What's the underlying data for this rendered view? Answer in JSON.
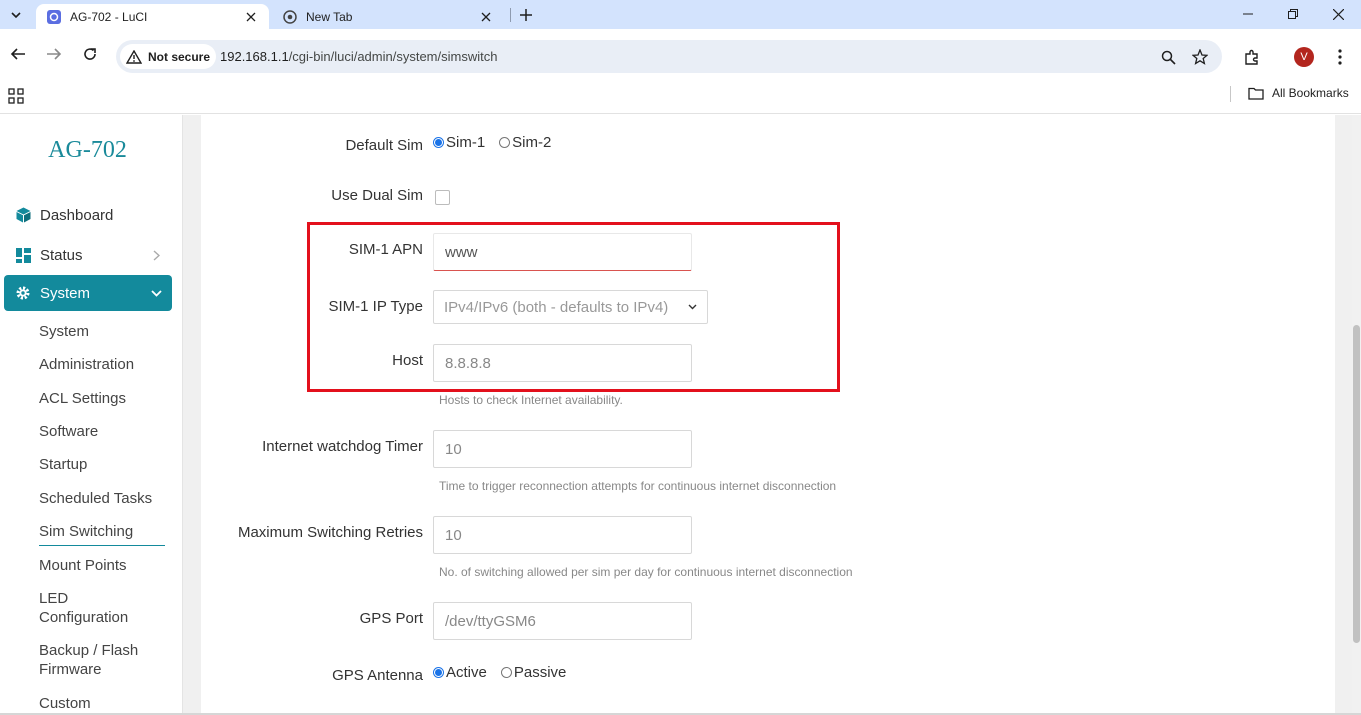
{
  "browser": {
    "tabs": [
      {
        "title": "AG-702 - LuCI",
        "active": true
      },
      {
        "title": "New Tab",
        "active": false
      }
    ],
    "security_label": "Not secure",
    "url_host": "192.168.1.1",
    "url_path": "/cgi-bin/luci/admin/system/simswitch",
    "profile_initial": "V",
    "all_bookmarks": "All Bookmarks"
  },
  "sidebar": {
    "brand": "AG-702",
    "items": [
      {
        "label": "Dashboard",
        "icon": "cube-icon"
      },
      {
        "label": "Status",
        "icon": "grid-icon"
      },
      {
        "label": "System",
        "icon": "gear-icon",
        "active": true
      }
    ],
    "sub_items": [
      "System",
      "Administration",
      "ACL Settings",
      "Software",
      "Startup",
      "Scheduled Tasks",
      "Sim Switching",
      "Mount Points",
      "LED Configuration",
      "Backup / Flash Firmware",
      "Custom"
    ],
    "current_sub_item": "Sim Switching"
  },
  "form": {
    "default_sim": {
      "label": "Default Sim",
      "options": [
        "Sim-1",
        "Sim-2"
      ],
      "selected": "Sim-1"
    },
    "use_dual_sim": {
      "label": "Use Dual Sim",
      "checked": false
    },
    "sim1_apn": {
      "label": "SIM-1 APN",
      "value": "www"
    },
    "sim1_ip_type": {
      "label": "SIM-1 IP Type",
      "value": "IPv4/IPv6 (both - defaults to IPv4)"
    },
    "host": {
      "label": "Host",
      "value": "8.8.8.8",
      "hint": "Hosts to check Internet availability."
    },
    "watchdog": {
      "label": "Internet watchdog Timer",
      "value": "10",
      "hint": "Time to trigger reconnection attempts for continuous internet disconnection"
    },
    "max_retries": {
      "label": "Maximum Switching Retries",
      "value": "10",
      "hint": "No. of switching allowed per sim per day for continuous internet disconnection"
    },
    "gps_port": {
      "label": "GPS Port",
      "value": "/dev/ttyGSM6"
    },
    "gps_antenna": {
      "label": "GPS Antenna",
      "options": [
        "Active",
        "Passive"
      ],
      "selected": "Active"
    }
  },
  "colors": {
    "accent": "#138a9c",
    "highlight_box": "#e3101c",
    "brand_text": "#1a8a9a"
  }
}
